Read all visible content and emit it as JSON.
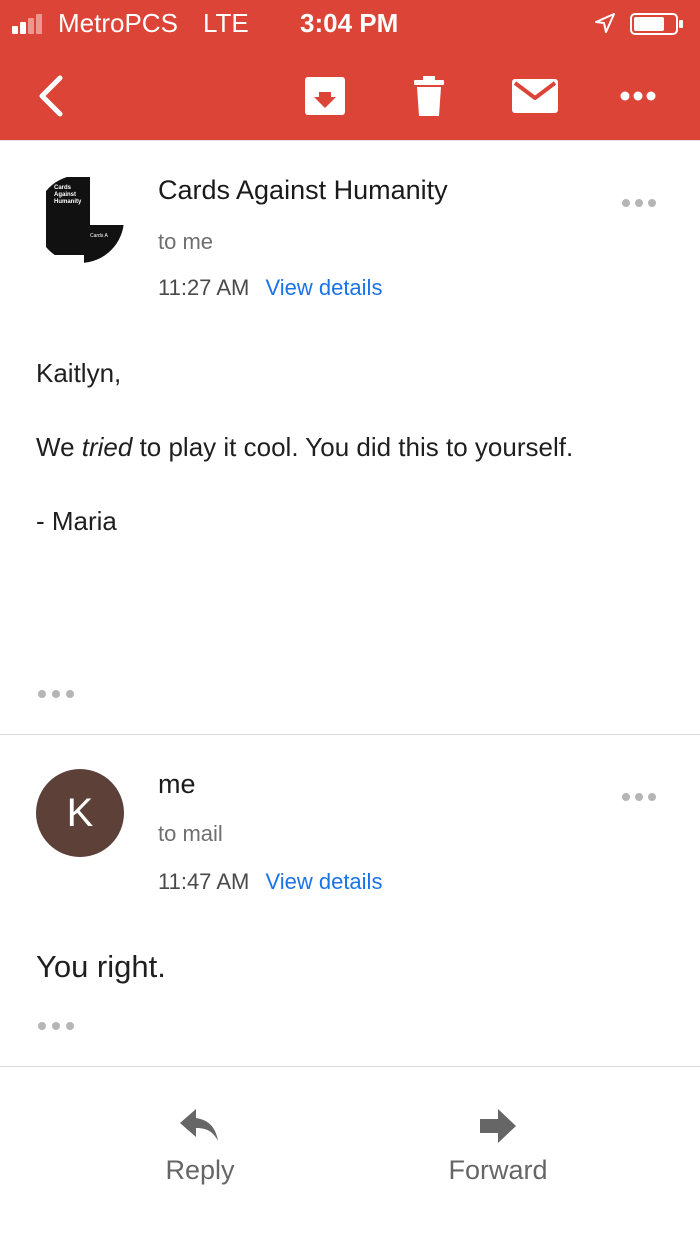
{
  "status_bar": {
    "carrier": "MetroPCS",
    "network": "LTE",
    "time": "3:04 PM",
    "signal_bars_filled": 2,
    "signal_bars_total": 5
  },
  "toolbar": {
    "icons": [
      "back-icon",
      "archive-icon",
      "trash-icon",
      "mail-icon",
      "more-icon"
    ],
    "accent_color": "#db4437"
  },
  "messages": [
    {
      "sender": "Cards Against Humanity",
      "to": "to me",
      "time": "11:27 AM",
      "view_details": "View details",
      "body_greeting": "Kaitlyn,",
      "body_line_pre": "We ",
      "body_line_em": "tried",
      "body_line_post": " to play it cool. You did this to yourself.",
      "body_sign": "- Maria",
      "avatar_lines": [
        "Cards",
        "Against",
        "Humanity"
      ],
      "avatar_card_text": "Cards A"
    },
    {
      "sender": "me",
      "to": "to mail",
      "time": "11:47 AM",
      "view_details": "View details",
      "body": "You right.",
      "avatar_initial": "K",
      "avatar_color": "#5d4037"
    }
  ],
  "footer": {
    "reply": "Reply",
    "forward": "Forward"
  }
}
